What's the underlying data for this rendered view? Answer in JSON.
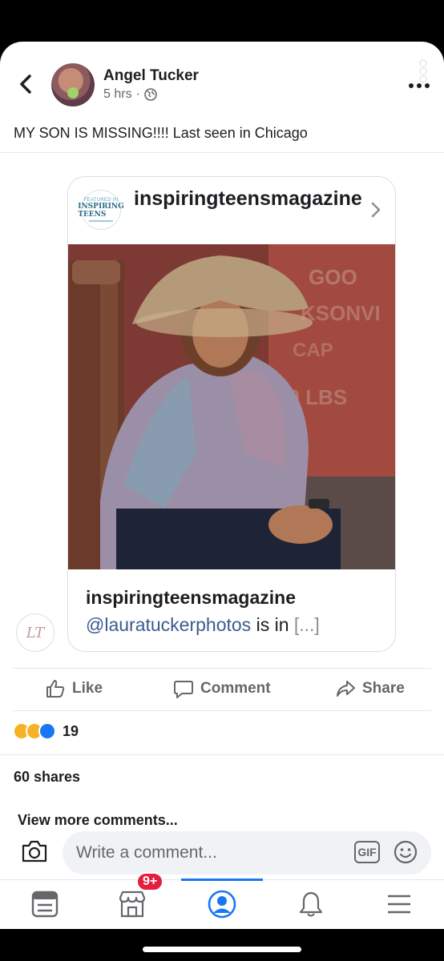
{
  "post": {
    "author": "Angel Tucker",
    "time": "5 hrs",
    "text": "MY SON IS MISSING!!!! Last seen in Chicago"
  },
  "shared_card": {
    "account": "inspiringteensmagazine",
    "logo_lines": [
      "FEATURED IN",
      "INSPIRING TEENS"
    ],
    "caption_user": "inspiringteensmagazine",
    "caption_mention": "@lauratuckerphotos",
    "caption_rest": " is in ",
    "caption_ellipsis": "[...]"
  },
  "actions": {
    "like": "Like",
    "comment": "Comment",
    "share": "Share"
  },
  "reactions": {
    "icons": [
      "sad-reaction-icon",
      "wow-reaction-icon",
      "like-reaction-icon"
    ],
    "count": "19"
  },
  "shares": "60 shares",
  "view_more": "View more comments...",
  "comment_box": {
    "placeholder": "Write a comment...",
    "gif": "GIF"
  },
  "tabbar": {
    "marketplace_badge": "9+",
    "active_tab": "profile"
  },
  "colors": {
    "accent": "#1877f2",
    "badge": "#e41e3f",
    "secondary_text": "#65676b"
  }
}
